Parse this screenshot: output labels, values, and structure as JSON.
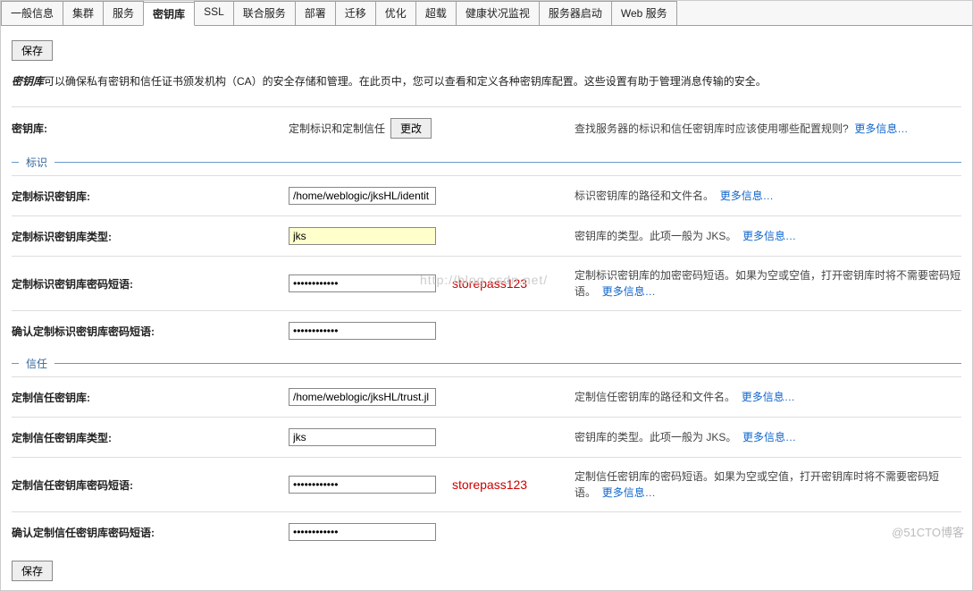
{
  "tabs": {
    "items": [
      "一般信息",
      "集群",
      "服务",
      "密钥库",
      "SSL",
      "联合服务",
      "部署",
      "迁移",
      "优化",
      "超载",
      "健康状况监视",
      "服务器启动",
      "Web 服务"
    ],
    "activeIndex": 3
  },
  "buttons": {
    "save": "保存",
    "change": "更改"
  },
  "desc_prefix": "密钥库",
  "description": "可以确保私有密钥和信任证书颁发机构（CA）的安全存储和管理。在此页中，您可以查看和定义各种密钥库配置。这些设置有助于管理消息传输的安全。",
  "moreInfo": "更多信息…",
  "keystoreRow": {
    "label": "密钥库:",
    "value": "定制标识和定制信任",
    "help": "查找服务器的标识和信任密钥库时应该使用哪些配置规则?"
  },
  "sections": {
    "identity": "标识",
    "trust": "信任"
  },
  "fields": {
    "identity_keystore": {
      "label": "定制标识密钥库:",
      "value": "/home/weblogic/jksHL/identit",
      "help": "标识密钥库的路径和文件名。"
    },
    "identity_type": {
      "label": "定制标识密钥库类型:",
      "value": "jks",
      "help": "密钥库的类型。此项一般为 JKS。"
    },
    "identity_pass": {
      "label": "定制标识密钥库密码短语:",
      "value": "••••••••••••",
      "annotation": "storepass123",
      "help": "定制标识密钥库的加密密码短语。如果为空或空值，打开密钥库时将不需要密码短语。"
    },
    "identity_pass_confirm": {
      "label": "确认定制标识密钥库密码短语:",
      "value": "••••••••••••"
    },
    "trust_keystore": {
      "label": "定制信任密钥库:",
      "value": "/home/weblogic/jksHL/trust.jl",
      "help": "定制信任密钥库的路径和文件名。"
    },
    "trust_type": {
      "label": "定制信任密钥库类型:",
      "value": "jks",
      "help": "密钥库的类型。此项一般为 JKS。"
    },
    "trust_pass": {
      "label": "定制信任密钥库密码短语:",
      "value": "••••••••••••",
      "annotation": "storepass123",
      "help": "定制信任密钥库的密码短语。如果为空或空值，打开密钥库时将不需要密码短语。"
    },
    "trust_pass_confirm": {
      "label": "确认定制信任密钥库密码短语:",
      "value": "••••••••••••"
    }
  },
  "watermark_center": "http://blog.csdn.net/",
  "watermark_corner": "@51CTO博客"
}
